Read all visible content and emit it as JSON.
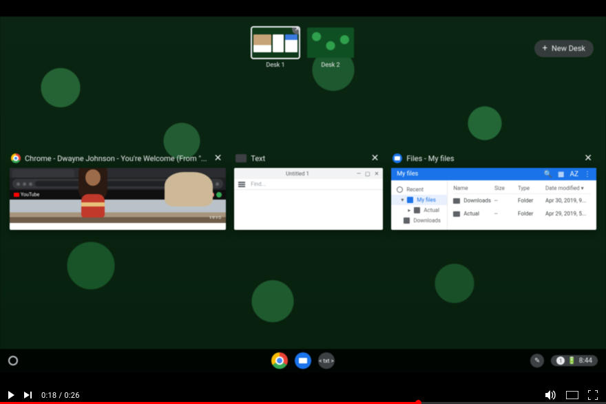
{
  "desks": {
    "list": [
      {
        "label": "Desk 1",
        "active": true
      },
      {
        "label": "Desk 2",
        "active": false
      }
    ],
    "new_desk_label": "New Desk"
  },
  "overview": {
    "chrome": {
      "title": "Chrome - Dwayne Johnson - You're Welcome (From \"...",
      "youtube_label": "YouTube",
      "watermark": "vevo"
    },
    "text": {
      "title": "Text",
      "doc_title": "Untitled 1",
      "search_placeholder": "Find..."
    },
    "files": {
      "title": "Files - My files",
      "breadcrumb": "My files",
      "sidebar": {
        "recent": "Recent",
        "myfiles": "My files",
        "actual": "Actual",
        "downloads": "Downloads"
      },
      "columns": {
        "name": "Name",
        "size": "Size",
        "type": "Type",
        "date": "Date modified"
      },
      "rows": [
        {
          "name": "Downloads",
          "size": "--",
          "type": "Folder",
          "date": "Apr 30, 2019, 9..."
        },
        {
          "name": "Actual",
          "size": "--",
          "type": "Folder",
          "date": "Apr 29, 2019, 5..."
        }
      ]
    }
  },
  "shelf": {
    "notification_count": "1",
    "clock": "8:44",
    "text_pin_label": "< txt >"
  },
  "player": {
    "current": "0:18",
    "sep": " / ",
    "total": "0:26",
    "progress_pct": 69
  }
}
